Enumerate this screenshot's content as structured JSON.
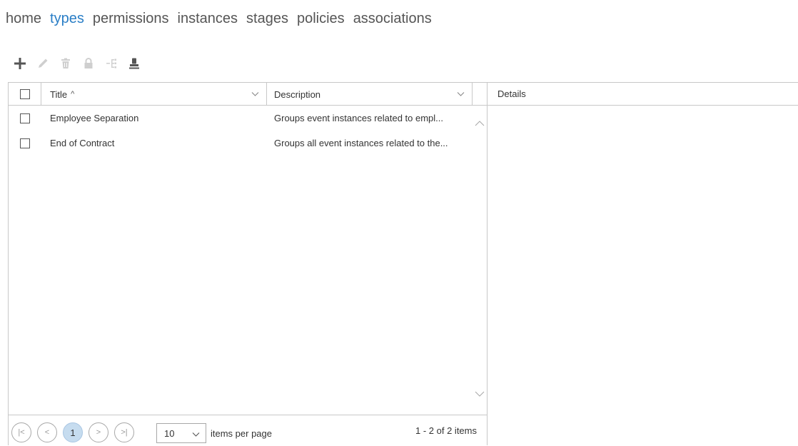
{
  "nav": {
    "items": [
      {
        "label": "home",
        "active": false
      },
      {
        "label": "types",
        "active": true
      },
      {
        "label": "permissions",
        "active": false
      },
      {
        "label": "instances",
        "active": false
      },
      {
        "label": "stages",
        "active": false
      },
      {
        "label": "policies",
        "active": false
      },
      {
        "label": "associations",
        "active": false
      }
    ],
    "active_color": "#2a7ec6"
  },
  "toolbar": {
    "buttons": [
      {
        "icon": "plus-icon",
        "enabled": true
      },
      {
        "icon": "pencil-icon",
        "enabled": false
      },
      {
        "icon": "trash-icon",
        "enabled": false
      },
      {
        "icon": "lock-icon",
        "enabled": false
      },
      {
        "icon": "hierarchy-icon",
        "enabled": false
      },
      {
        "icon": "stamp-icon",
        "enabled": true
      }
    ]
  },
  "grid": {
    "columns": {
      "title": "Title",
      "title_sort": "^",
      "description": "Description"
    },
    "rows": [
      {
        "title": "Employee Separation",
        "description": "Groups event instances related to empl..."
      },
      {
        "title": "End of Contract",
        "description": "Groups all event instances related to the..."
      }
    ]
  },
  "pager": {
    "first": "|<",
    "prev": "<",
    "current_page": "1",
    "next": ">",
    "last": ">|",
    "page_size": "10",
    "items_per_page_label": "items per page",
    "info": "1 - 2 of 2 items"
  },
  "details": {
    "header": "Details"
  }
}
